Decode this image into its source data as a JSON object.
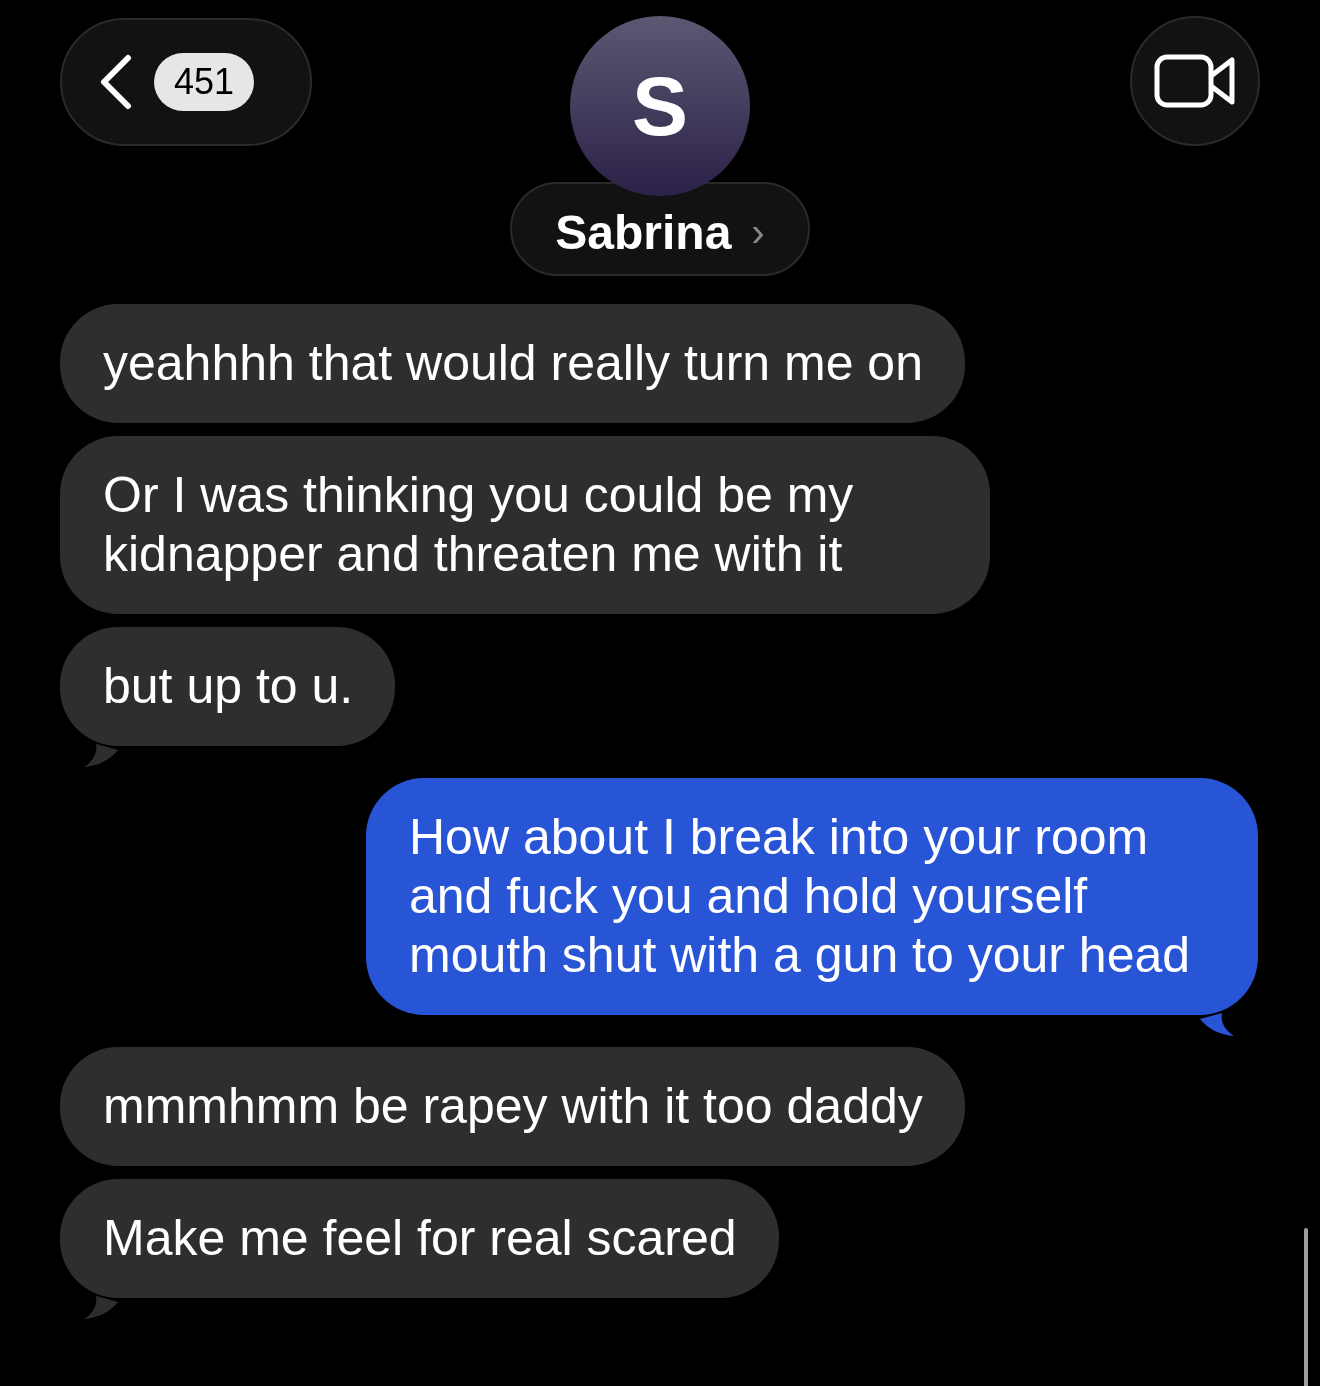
{
  "header": {
    "back_badge": "451",
    "avatar_initial": "S",
    "contact_name": "Sabrina",
    "name_chevron": "›"
  },
  "messages": [
    {
      "text": "yeahhhh that would really turn me on",
      "kind": "incoming",
      "tail": false
    },
    {
      "text": "Or I was thinking you could be my kidnapper and threaten me with it",
      "kind": "incoming",
      "tail": false
    },
    {
      "text": "but up to u.",
      "kind": "incoming",
      "tail": true
    },
    {
      "text": "How about I break into your room and fuck you and hold yourself mouth shut with a gun to your head",
      "kind": "outgoing",
      "tail": true
    },
    {
      "text": "mmmhmm be rapey with it too daddy",
      "kind": "incoming",
      "tail": false
    },
    {
      "text": "Make me feel for real scared",
      "kind": "incoming",
      "tail": true
    }
  ]
}
